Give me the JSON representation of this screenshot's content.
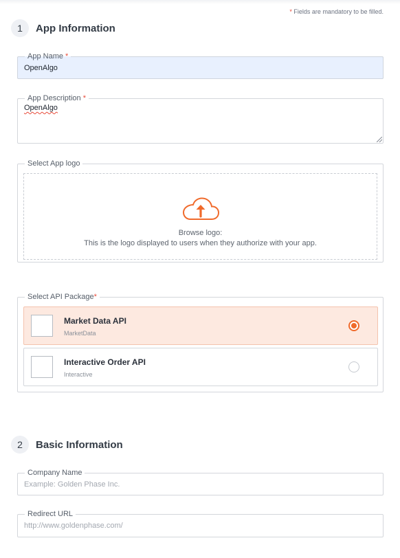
{
  "notice": {
    "star": "*",
    "text": "Fields are mandatory to be filled."
  },
  "sections": [
    {
      "number": "1",
      "title": "App Information"
    },
    {
      "number": "2",
      "title": "Basic Information"
    }
  ],
  "app_name": {
    "label": "App Name",
    "required_mark": "*",
    "value": "OpenAlgo"
  },
  "app_description": {
    "label": "App Description",
    "required_mark": "*",
    "value": "OpenAlgo"
  },
  "app_logo": {
    "label": "Select App logo",
    "icon": "cloud-upload-icon",
    "browse_title": "Browse logo:",
    "browse_hint": "This is the logo displayed to users when they authorize with your app."
  },
  "api_package": {
    "label": "Select API Package",
    "required_mark": "*",
    "options": [
      {
        "title": "Market Data API",
        "subtitle": "MarketData",
        "selected": true
      },
      {
        "title": "Interactive Order API",
        "subtitle": "Interactive",
        "selected": false
      }
    ]
  },
  "company_name": {
    "label": "Company Name",
    "placeholder": "Example: Golden Phase Inc."
  },
  "redirect_url": {
    "label": "Redirect URL",
    "placeholder": "http://www.goldenphase.com/"
  },
  "colors": {
    "accent": "#f06a2b",
    "selected_bg": "#fde9e0",
    "autofill_bg": "#e8f0fe",
    "required": "#e84b3a"
  }
}
